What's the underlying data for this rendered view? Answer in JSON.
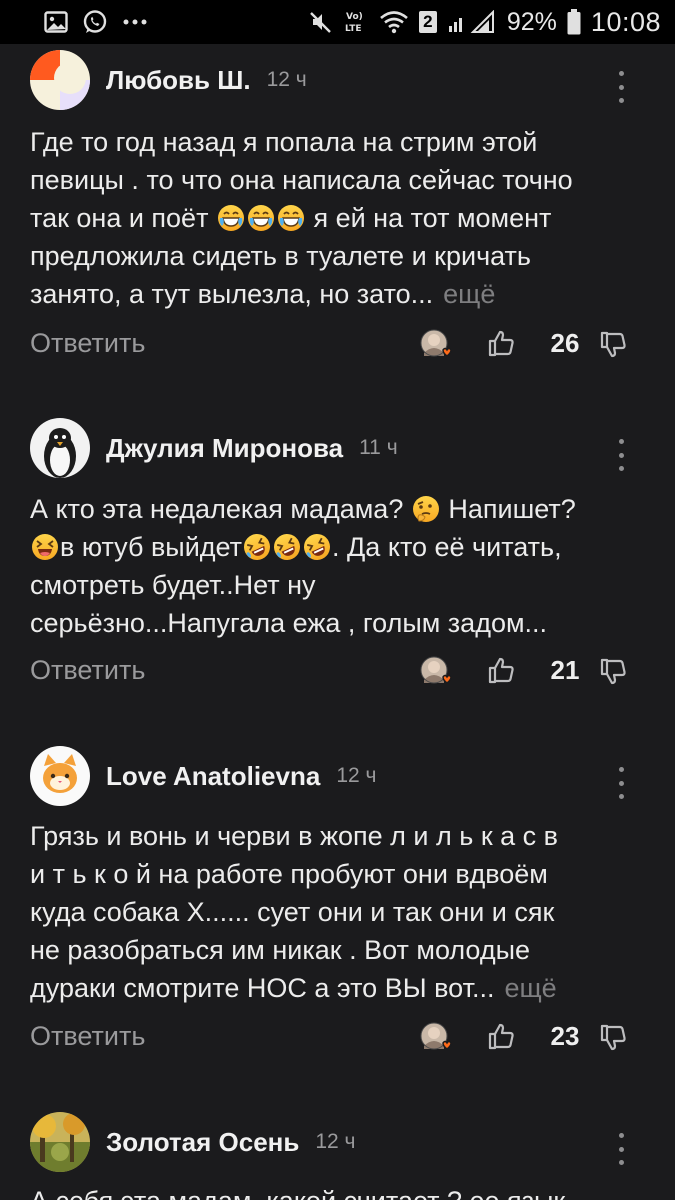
{
  "status_bar": {
    "network_label": "LTE",
    "sim_badge": "2",
    "battery": "92%",
    "time": "10:08"
  },
  "comments": [
    {
      "author": "Любовь Ш.",
      "time": "12 ч",
      "lines": [
        [
          "Где то год назад я попала на стрим этой"
        ],
        [
          "певицы . то что она написала сейчас точно"
        ],
        [
          "так она и поёт ",
          "{grin-sweat}",
          "{grin-sweat}",
          "{grin-sweat}",
          " я ей на тот момент"
        ],
        [
          "предложила сидеть в туалете и кричать"
        ],
        [
          "занято, а тут вылезла, но зато..."
        ]
      ],
      "more": "ещё",
      "reply": "Ответить",
      "likes": "26"
    },
    {
      "author": "Джулия Миронова",
      "time": "11 ч",
      "lines": [
        [
          "А кто эта недалекая мадама? ",
          "{thinking}",
          " Напишет?"
        ],
        [
          "{laughing}",
          "в ютуб выйдет",
          "{rofl}",
          "{rofl}",
          "{rofl}",
          ". Да кто её читать,"
        ],
        [
          "смотреть будет..Нет ну"
        ],
        [
          "серьёзно...Напугала ежа , голым задом..."
        ]
      ],
      "more": "",
      "reply": "Ответить",
      "likes": "21"
    },
    {
      "author": "Love Anatolievna",
      "time": "12 ч",
      "lines": [
        [
          "Грязь и вонь и черви в жопе л и л ь к а с в"
        ],
        [
          "и т ь к о й на работе пробуют они вдвоём"
        ],
        [
          "куда собака Х...... сует они и так они и сяк"
        ],
        [
          "не разобраться им никак . Вот молодые"
        ],
        [
          "дураки смотрите НОС а это ВЫ вот..."
        ]
      ],
      "more": "ещё",
      "reply": "Ответить",
      "likes": "23"
    },
    {
      "author": "Золотая Осень",
      "time": "12 ч",
      "lines": [
        [
          "А себя эта мадам, какой считает ? ее язык"
        ]
      ],
      "more": "",
      "reply": "",
      "likes": ""
    }
  ]
}
